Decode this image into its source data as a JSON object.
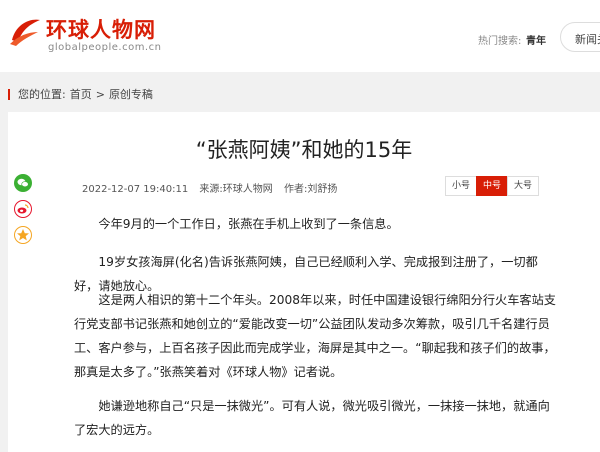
{
  "site": {
    "logo_text": "环球人物网",
    "logo_sub": "globalpeople.com.cn",
    "hot_search_label": "热门搜索:",
    "hot_search_term": "青年",
    "search_placeholder": "新闻关",
    "brand_color": "#d81e06"
  },
  "breadcrumb": {
    "prefix": "您的位置:",
    "home": "首页",
    "sep": ">",
    "section": "原创专稿"
  },
  "article": {
    "title": "“张燕阿姨”和她的15年",
    "date": "2022-12-07 19:40:11",
    "source": "来源:环球人物网",
    "author": "作者:刘舒扬",
    "font_sizes": [
      "小号",
      "中号",
      "大号"
    ],
    "active_size": "中号",
    "paragraphs": [
      "今年9月的一个工作日，张燕在手机上收到了一条信息。",
      "19岁女孩海屏(化名)告诉张燕阿姨，自己已经顺利入学、完成报到注册了，一切都好，请她放心。",
      "这是两人相识的第十二个年头。2008年以来，时任中国建设银行绵阳分行火车客站支行党支部书记张燕和她创立的“爱能改变一切”公益团队发动多次筹款，吸引几千名建行员工、客户参与，上百名孩子因此而完成学业，海屏是其中之一。“聊起我和孩子们的故事，那真是太多了。”张燕笑着对《环球人物》记者说。",
      "她谦逊地称自己“只是一抹微光”。可有人说，微光吸引微光，一抹接一抹地，就通向了宏大的远方。"
    ]
  },
  "share": {
    "icons": [
      "wechat-icon",
      "weibo-icon",
      "qzone-icon"
    ],
    "colors": {
      "wechat": "#3bb033",
      "weibo": "#e6162d",
      "qzone": "#f5a623"
    }
  }
}
